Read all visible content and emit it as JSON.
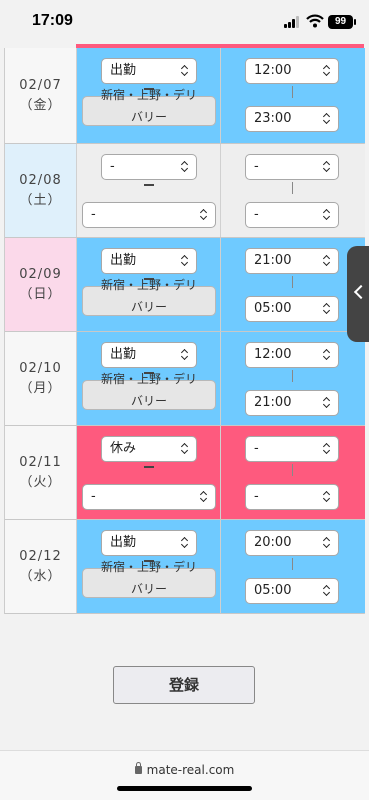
{
  "status": {
    "time": "17:09",
    "battery": "99"
  },
  "colors": {
    "blue": "#6fcaff",
    "pink": "#fe5a7e",
    "grey": "#eeeeee",
    "sat_bg": "#dff0fb",
    "sun_bg": "#fbd9ea",
    "weekday_bg": "#f7f7f7",
    "area_bg": "#e6e6e6"
  },
  "rows": [
    {
      "date": "02/07",
      "weekday": "（金）",
      "status": "出勤",
      "area": [
        "新宿・上野・デリ",
        "バリー"
      ],
      "start": "12:00",
      "end": "23:00",
      "col_state": "work",
      "day_type": "weekday"
    },
    {
      "date": "02/08",
      "weekday": "（土）",
      "status": "-",
      "area_select": "-",
      "start": "-",
      "end": "-",
      "col_state": "none",
      "day_type": "sat"
    },
    {
      "date": "02/09",
      "weekday": "（日）",
      "status": "出勤",
      "area": [
        "新宿・上野・デリ",
        "バリー"
      ],
      "start": "21:00",
      "end": "05:00",
      "col_state": "work",
      "day_type": "sun"
    },
    {
      "date": "02/10",
      "weekday": "（月）",
      "status": "出勤",
      "area": [
        "新宿・上野・デリ",
        "バリー"
      ],
      "start": "12:00",
      "end": "21:00",
      "col_state": "work",
      "day_type": "weekday"
    },
    {
      "date": "02/11",
      "weekday": "（火）",
      "status": "休み",
      "area_select": "-",
      "start": "-",
      "end": "-",
      "col_state": "off",
      "day_type": "weekday"
    },
    {
      "date": "02/12",
      "weekday": "（水）",
      "status": "出勤",
      "area": [
        "新宿・上野・デリ",
        "バリー"
      ],
      "start": "20:00",
      "end": "05:00",
      "col_state": "work",
      "day_type": "weekday"
    }
  ],
  "submit_label": "登録",
  "browser": {
    "url": "mate-real.com"
  },
  "icons": {
    "side_toggle": "chevron-left-icon",
    "select_arrow": "updown-chevron-icon",
    "lock": "lock-icon"
  }
}
